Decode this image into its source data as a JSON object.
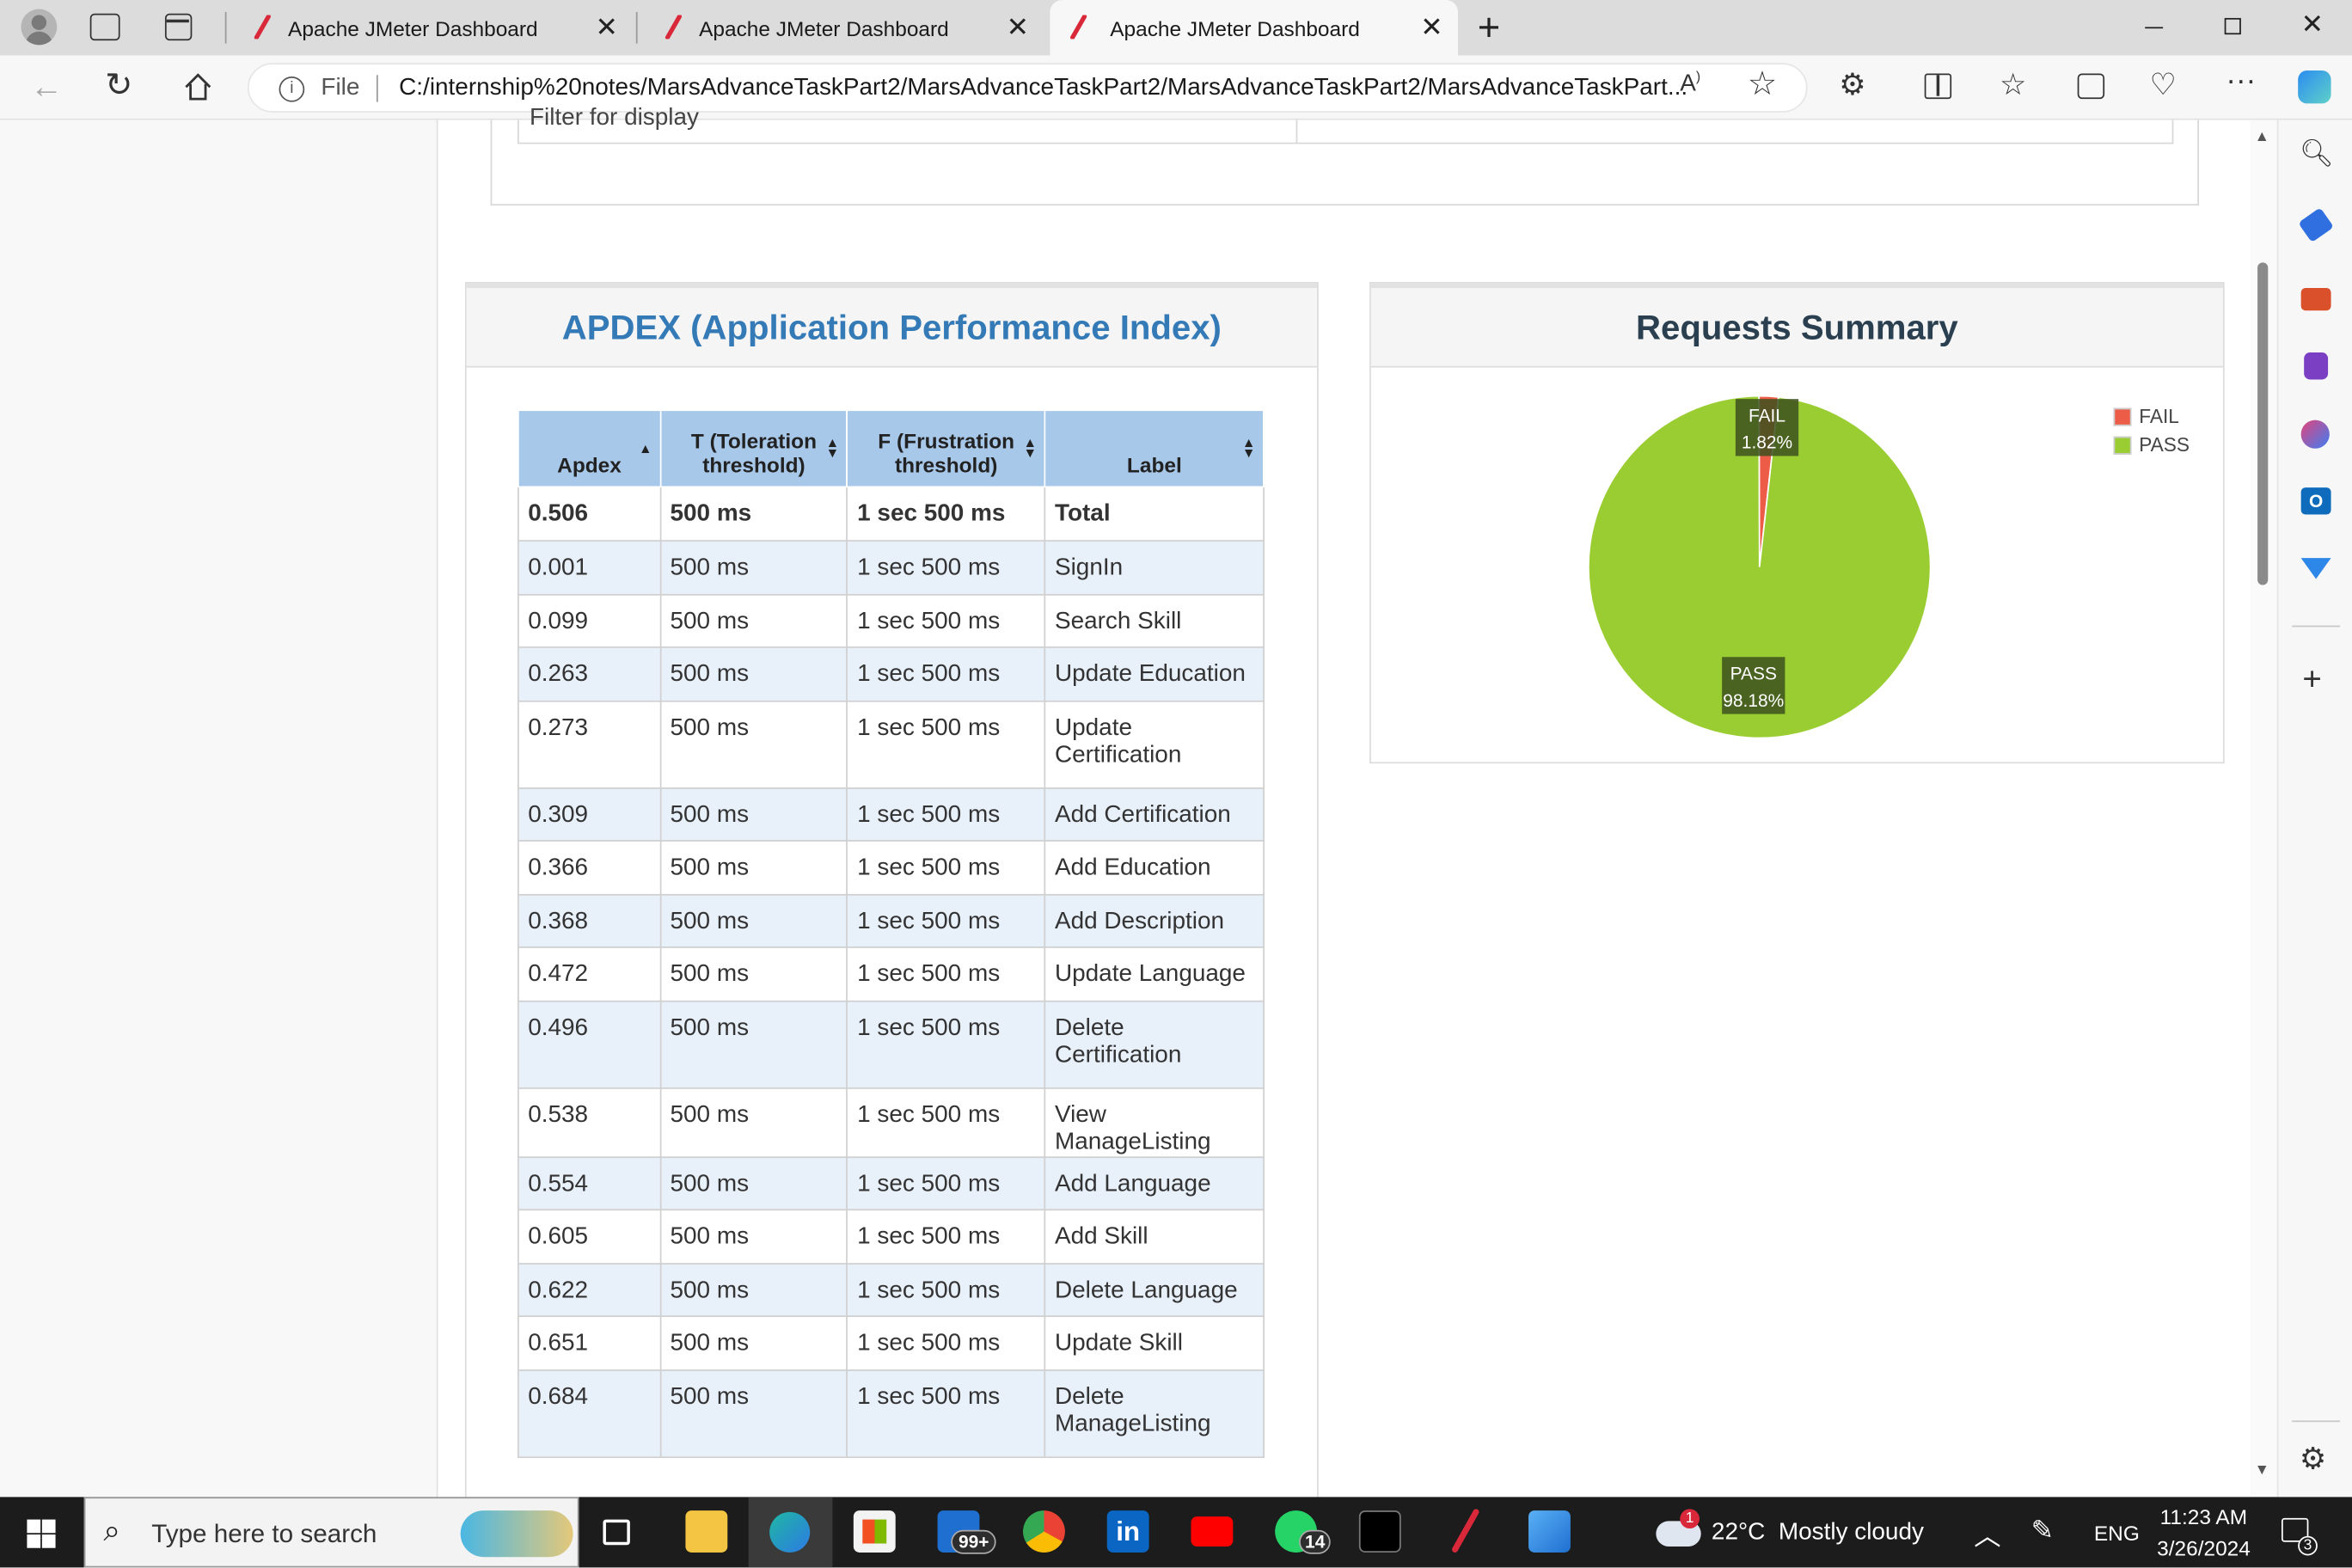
{
  "browser": {
    "tabs": [
      {
        "title": "Apache JMeter Dashboard"
      },
      {
        "title": "Apache JMeter Dashboard"
      },
      {
        "title": "Apache JMeter Dashboard"
      }
    ],
    "new_tab_label": "+",
    "file_label": "File",
    "url": "C:/internship%20notes/MarsAdvanceTaskPart2/MarsAdvanceTaskPart2/MarsAdvanceTaskPart2/MarsAdvanceTaskPart..."
  },
  "filter_fragment": "Filter for display",
  "apdex": {
    "title": "APDEX (Application Performance Index)",
    "headers": {
      "apdex": "Apdex",
      "toleration": "T (Toleration threshold)",
      "frustration": "F (Frustration threshold)",
      "label": "Label"
    },
    "rows": [
      {
        "apdex": "0.506",
        "t": "500 ms",
        "f": "1 sec 500 ms",
        "label": "Total"
      },
      {
        "apdex": "0.001",
        "t": "500 ms",
        "f": "1 sec 500 ms",
        "label": "SignIn"
      },
      {
        "apdex": "0.099",
        "t": "500 ms",
        "f": "1 sec 500 ms",
        "label": "Search Skill"
      },
      {
        "apdex": "0.263",
        "t": "500 ms",
        "f": "1 sec 500 ms",
        "label": "Update Education"
      },
      {
        "apdex": "0.273",
        "t": "500 ms",
        "f": "1 sec 500 ms",
        "label": "Update Certification"
      },
      {
        "apdex": "0.309",
        "t": "500 ms",
        "f": "1 sec 500 ms",
        "label": "Add Certification"
      },
      {
        "apdex": "0.366",
        "t": "500 ms",
        "f": "1 sec 500 ms",
        "label": "Add Education"
      },
      {
        "apdex": "0.368",
        "t": "500 ms",
        "f": "1 sec 500 ms",
        "label": "Add Description"
      },
      {
        "apdex": "0.472",
        "t": "500 ms",
        "f": "1 sec 500 ms",
        "label": "Update Language"
      },
      {
        "apdex": "0.496",
        "t": "500 ms",
        "f": "1 sec 500 ms",
        "label": "Delete Certification"
      },
      {
        "apdex": "0.538",
        "t": "500 ms",
        "f": "1 sec 500 ms",
        "label": "View ManageListing"
      },
      {
        "apdex": "0.554",
        "t": "500 ms",
        "f": "1 sec 500 ms",
        "label": "Add Language"
      },
      {
        "apdex": "0.605",
        "t": "500 ms",
        "f": "1 sec 500 ms",
        "label": "Add Skill"
      },
      {
        "apdex": "0.622",
        "t": "500 ms",
        "f": "1 sec 500 ms",
        "label": "Delete Language"
      },
      {
        "apdex": "0.651",
        "t": "500 ms",
        "f": "1 sec 500 ms",
        "label": "Update Skill"
      },
      {
        "apdex": "0.684",
        "t": "500 ms",
        "f": "1 sec 500 ms",
        "label": "Delete ManageListing"
      }
    ]
  },
  "requests_summary": {
    "title": "Requests Summary",
    "legend": [
      {
        "name": "FAIL",
        "color": "#ec5c46"
      },
      {
        "name": "PASS",
        "color": "#9acd32"
      }
    ]
  },
  "chart_data": {
    "type": "pie",
    "title": "Requests Summary",
    "slices": [
      {
        "name": "FAIL",
        "value": 1.82,
        "label": "1.82%",
        "color": "#ec5c46"
      },
      {
        "name": "PASS",
        "value": 98.18,
        "label": "98.18%",
        "color": "#9acd32"
      }
    ],
    "legend_position": "top-right"
  },
  "taskbar": {
    "search_placeholder": "Type here to search",
    "mail_badge": "99+",
    "whatsapp_badge": "14",
    "weather_badge": "1",
    "weather": "22°C  Mostly cloudy",
    "language": "ENG",
    "time": "11:23 AM",
    "date": "3/26/2024",
    "notification_badge": "3"
  }
}
